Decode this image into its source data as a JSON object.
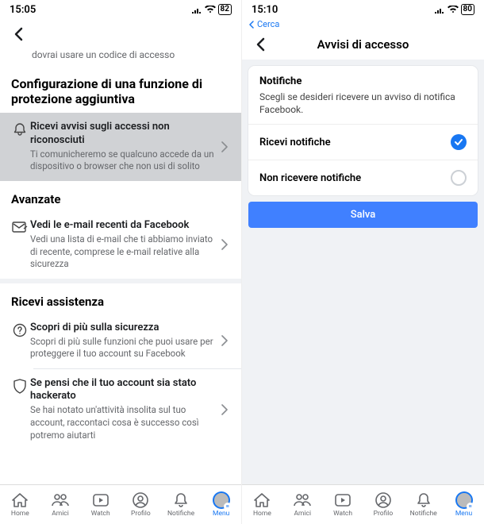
{
  "left": {
    "status": {
      "time": "15:05",
      "battery": "82"
    },
    "truncated_prev": "dovrai usare un codice di accesso",
    "section1_title": "Configurazione di una funzione di protezione aggiuntiva",
    "row_alerts": {
      "title": "Ricevi avvisi sugli accessi non riconosciuti",
      "sub": "Ti comunicheremo se qualcuno accede da un dispositivo o browser che non usi di solito"
    },
    "section2_title": "Avanzate",
    "row_emails": {
      "title": "Vedi le e-mail recenti da Facebook",
      "sub": "Vedi una lista di e-mail che ti abbiamo inviato di recente, comprese le e-mail relative alla sicurezza"
    },
    "section3_title": "Ricevi assistenza",
    "row_learnmore": {
      "title": "Scopri di più sulla sicurezza",
      "sub": "Scopri di più sulle funzioni che puoi usare per proteggere il tuo account su Facebook"
    },
    "row_hacked": {
      "title": "Se pensi che il tuo account sia stato hackerato",
      "sub": "Se hai notato un'attività insolita sul tuo account, raccontaci cosa è successo così potremo aiutarti"
    }
  },
  "right": {
    "status": {
      "time": "15:10",
      "battery": "80"
    },
    "search_back": "Cerca",
    "header_title": "Avvisi di accesso",
    "card": {
      "title": "Notifiche",
      "sub": "Scegli se desideri ricevere un avviso di notifica Facebook."
    },
    "options": {
      "on": "Ricevi notifiche",
      "off": "Non ricevere notifiche"
    },
    "save_label": "Salva"
  },
  "tabs": {
    "home": "Home",
    "friends": "Amici",
    "watch": "Watch",
    "profile": "Profilo",
    "notifications": "Notifiche",
    "menu": "Menu"
  }
}
